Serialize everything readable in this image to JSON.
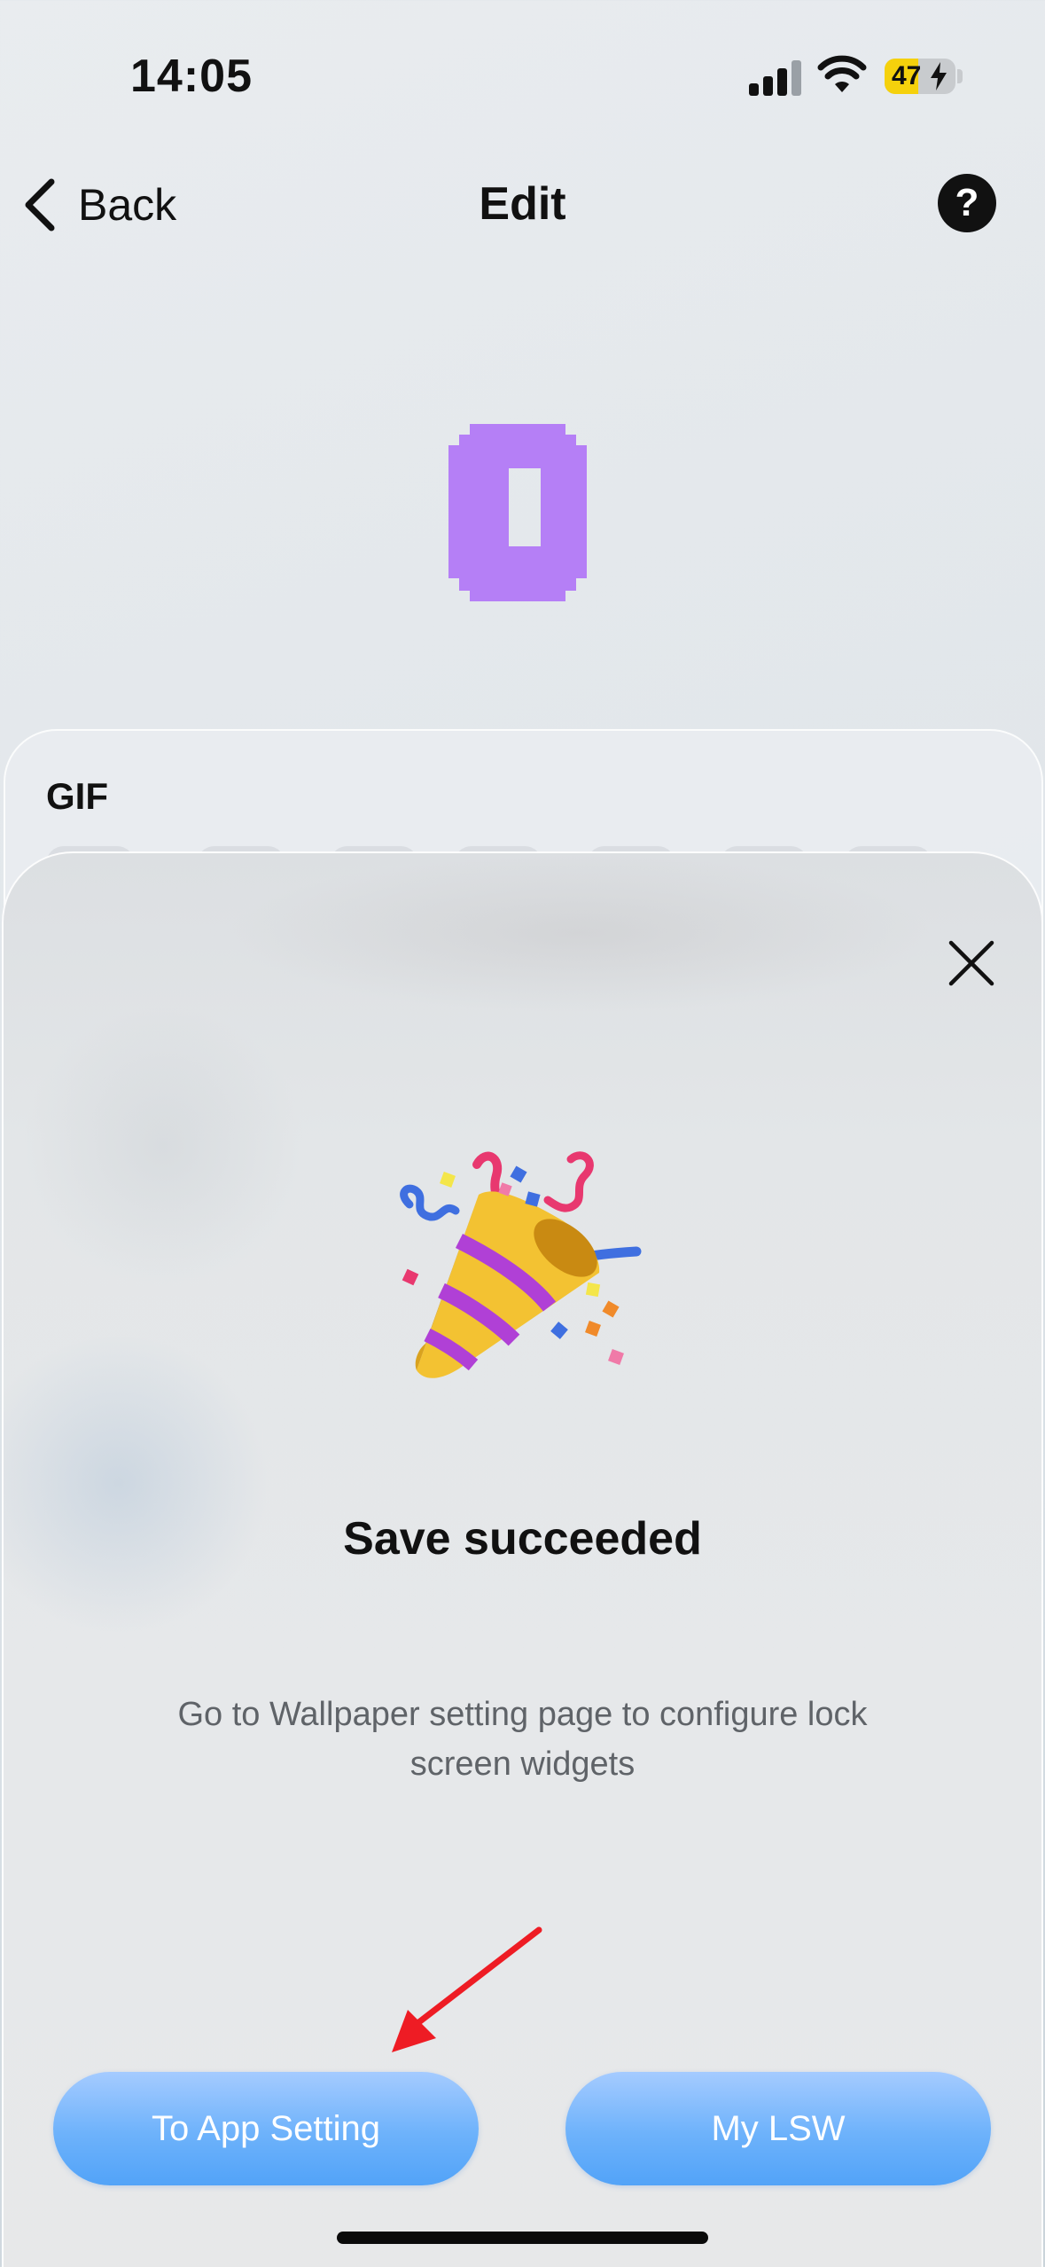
{
  "status_bar": {
    "time": "14:05",
    "battery_percent": "47",
    "battery_level": 0.47,
    "battery_color": "#f5d10c"
  },
  "nav": {
    "back_label": "Back",
    "title": "Edit",
    "help_label": "?"
  },
  "panel": {
    "section_label": "GIF"
  },
  "modal": {
    "title": "Save succeeded",
    "message": "Go to Wallpaper setting page to configure lock screen widgets",
    "primary_button": "To App Setting",
    "secondary_button": "My LSW"
  },
  "icons": {
    "back": "chevron-left-icon",
    "help": "question-icon",
    "close": "close-icon",
    "celebration": "party-popper-icon",
    "annotation": "red-arrow-icon"
  },
  "colors": {
    "preview_accent": "#b57ff6",
    "button_blue": "#5ba8f9",
    "arrow_red": "#ee1c24"
  }
}
